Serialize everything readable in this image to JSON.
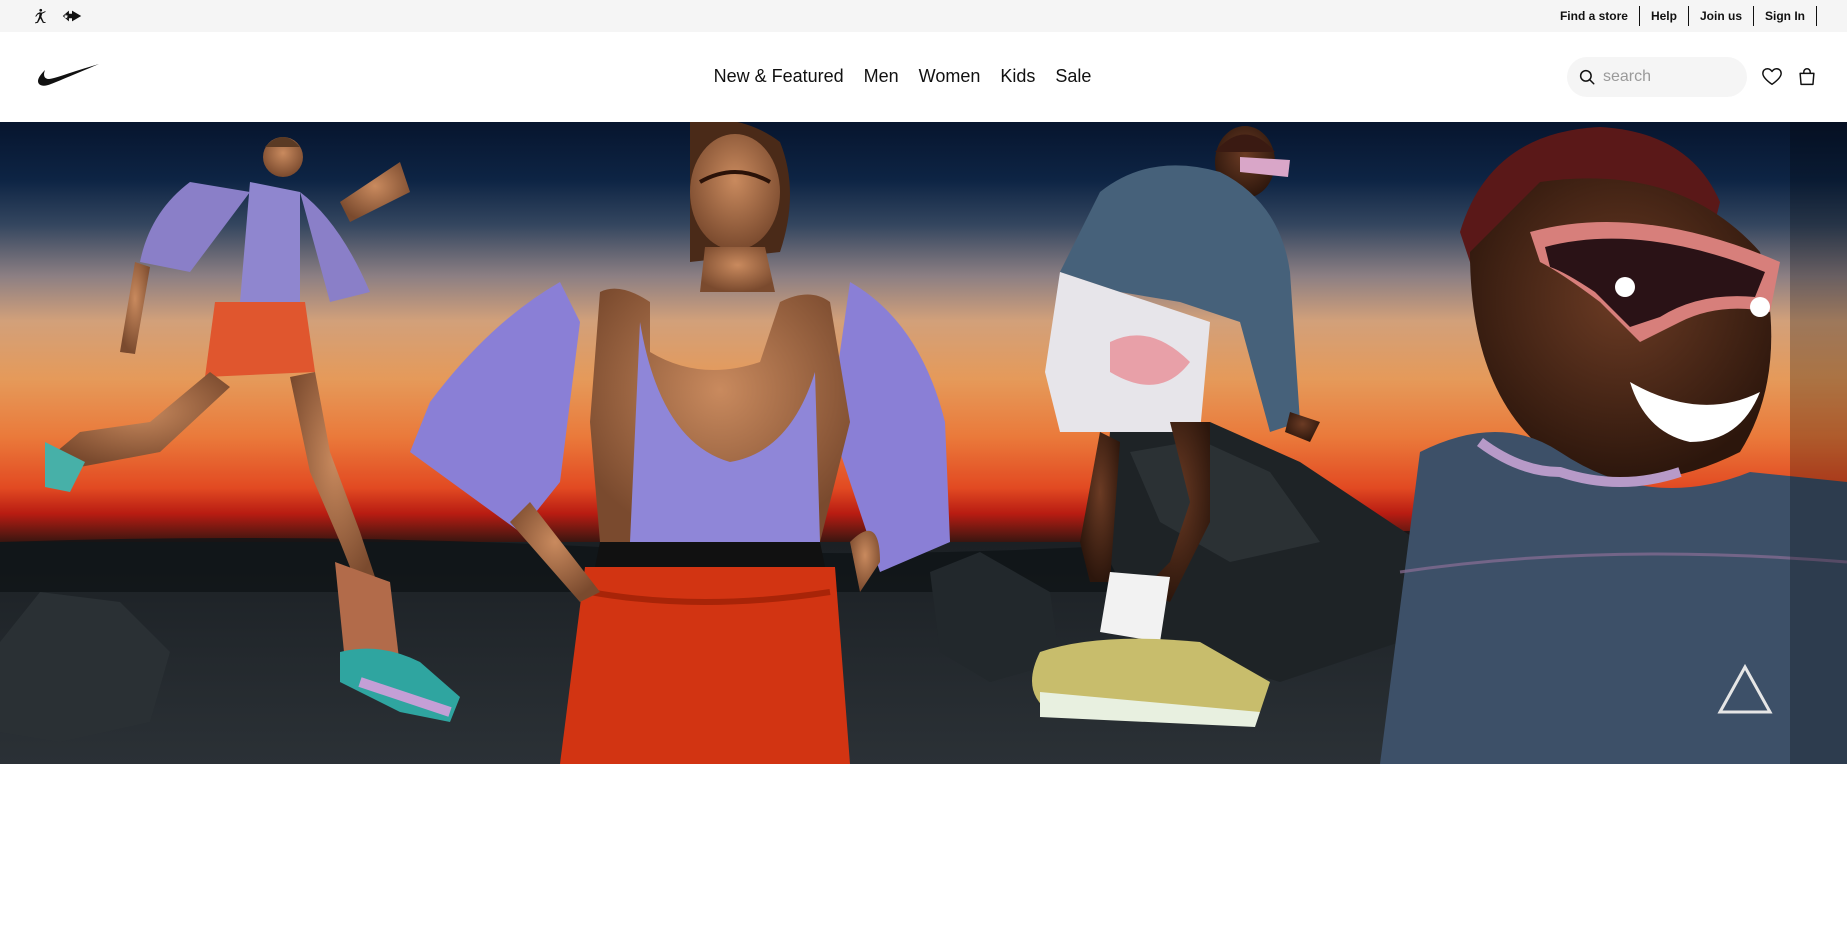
{
  "utility_bar": {
    "brand_icons": [
      "jordan-jumpman-icon",
      "converse-icon"
    ],
    "links": [
      "Find a store",
      "Help",
      "Join us",
      "Sign In"
    ]
  },
  "header": {
    "logo": "nike-swoosh-icon",
    "nav": [
      "New & Featured",
      "Men",
      "Women",
      "Kids",
      "Sale"
    ],
    "search": {
      "placeholder": "search",
      "value": ""
    },
    "icons": [
      "heart-icon",
      "bag-icon"
    ]
  },
  "hero": {
    "image": "hero-athletes-sunset-image"
  },
  "colors": {
    "utility_bg": "#f5f5f5",
    "text": "#111111",
    "search_bg": "#f5f5f5",
    "hero_sky_top": "#07152e",
    "hero_horizon": "#e24a22"
  }
}
